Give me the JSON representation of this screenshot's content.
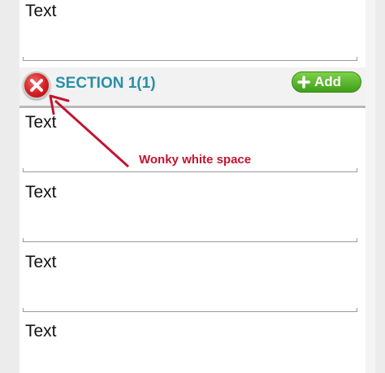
{
  "fields": [
    {
      "text": "Text"
    },
    {
      "text": "Text"
    },
    {
      "text": "Text"
    },
    {
      "text": "Text"
    },
    {
      "text": "Text"
    }
  ],
  "section": {
    "title": "SECTION 1(1)",
    "add_label": "Add",
    "add_icon": "plus-icon",
    "remove_icon": "close-icon"
  },
  "annotation": {
    "text": "Wonky white space",
    "color": "#c2152f"
  },
  "colors": {
    "section_title": "#2a8fa8",
    "add_button": "#4fae22",
    "remove_button": "#d41f1f"
  }
}
